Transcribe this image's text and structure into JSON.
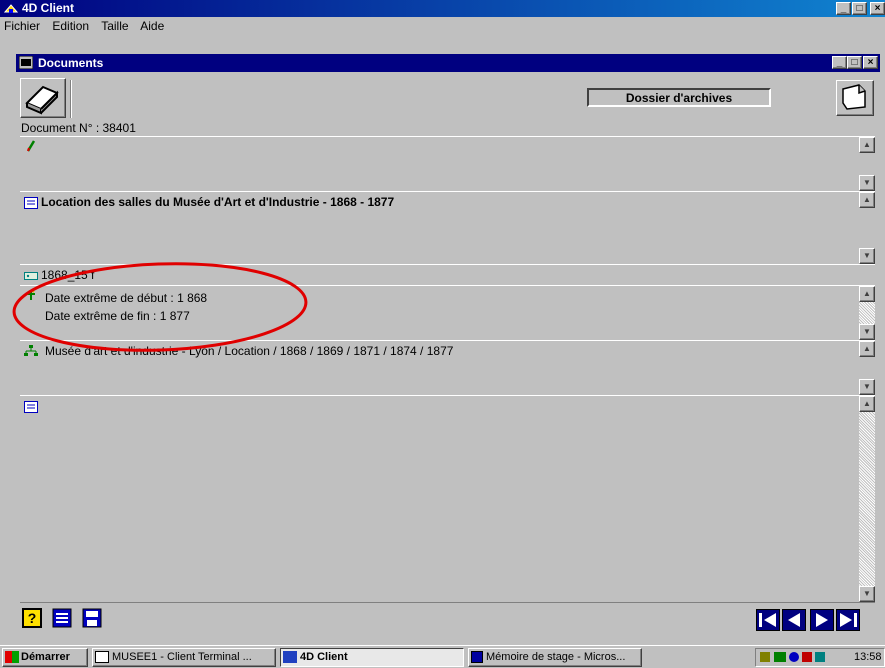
{
  "app": {
    "title": "4D Client",
    "menu": [
      {
        "label": "Fichier"
      },
      {
        "label": "Edition"
      },
      {
        "label": "Taille"
      },
      {
        "label": "Aide"
      }
    ]
  },
  "window": {
    "title": "Documents",
    "dossier_label": "Dossier d'archives",
    "document_number_label": "Document N° : 38401"
  },
  "fields": {
    "title_text": "Location des salles du Musée d'Art et d'Industrie - 1868 - 1877",
    "cote_text": "1868_15 f",
    "date_start": "Date extrême de début : 1 868",
    "date_end": "Date extrême de fin : 1 877",
    "hierarchy_text": "Musée d'art et d'industrie - Lyon / Location / 1868 / 1869 / 1871 / 1874 / 1877"
  },
  "annotation": {
    "color": "#e00000"
  },
  "taskbar": {
    "start_label": "Démarrer",
    "tasks": [
      {
        "label": "MUSEE1 - Client Terminal ..."
      },
      {
        "label": "4D Client"
      },
      {
        "label": "Mémoire de stage - Micros..."
      }
    ],
    "clock": "13:58"
  }
}
